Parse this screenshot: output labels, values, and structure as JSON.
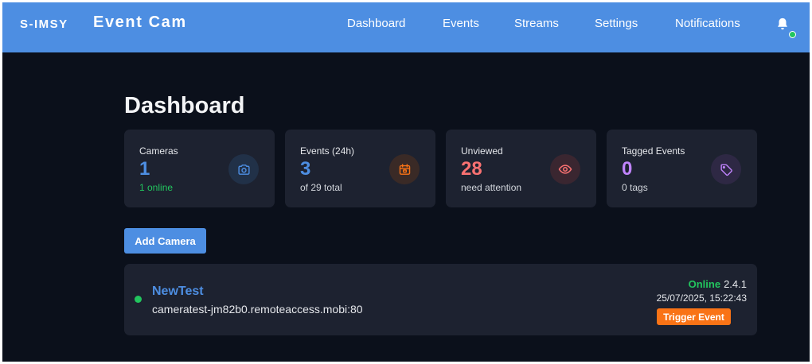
{
  "header": {
    "logo": "S-IMSY",
    "title": "Event Cam",
    "nav": [
      {
        "label": "Dashboard"
      },
      {
        "label": "Events"
      },
      {
        "label": "Streams"
      },
      {
        "label": "Settings"
      },
      {
        "label": "Notifications"
      }
    ],
    "bell_icon": "bell-icon",
    "status_color": "#22c55e"
  },
  "page": {
    "title": "Dashboard"
  },
  "stats": [
    {
      "label": "Cameras",
      "value": "1",
      "sub": "1 online",
      "icon": "camera-icon",
      "value_color": "#4d8ee2",
      "sub_color": "#22c55e"
    },
    {
      "label": "Events (24h)",
      "value": "3",
      "sub": "of 29 total",
      "icon": "calendar-icon",
      "value_color": "#4d8ee2",
      "sub_color": "#d1d5db"
    },
    {
      "label": "Unviewed",
      "value": "28",
      "sub": "need attention",
      "icon": "eye-icon",
      "value_color": "#f87171",
      "sub_color": "#d1d5db"
    },
    {
      "label": "Tagged Events",
      "value": "0",
      "sub": "0 tags",
      "icon": "tag-icon",
      "value_color": "#c084fc",
      "sub_color": "#d1d5db"
    }
  ],
  "actions": {
    "add_camera": "Add Camera"
  },
  "cameras": [
    {
      "name": "NewTest",
      "host": "cameratest-jm82b0.remoteaccess.mobi:80",
      "status": "Online",
      "version": "2.4.1",
      "timestamp": "25/07/2025, 15:22:43",
      "trigger_label": "Trigger Event"
    }
  ],
  "colors": {
    "accent": "#4d8ee2",
    "background": "#0b101b",
    "card": "#1d2230",
    "online": "#22c55e",
    "warning": "#f97316"
  }
}
